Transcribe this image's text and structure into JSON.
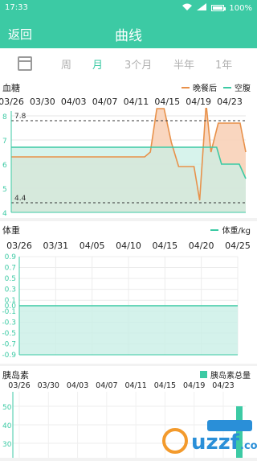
{
  "status_bar": {
    "time": "17:33",
    "battery": "100%",
    "battery_level": 1.0
  },
  "header": {
    "back_label": "返回",
    "title": "曲线"
  },
  "tabs": [
    {
      "label": "周",
      "active": false
    },
    {
      "label": "月",
      "active": true
    },
    {
      "label": "3个月",
      "active": false
    },
    {
      "label": "半年",
      "active": false
    },
    {
      "label": "1年",
      "active": false
    }
  ],
  "blood_sugar": {
    "title": "血糖",
    "legend_after": "晚餐后",
    "legend_fasting": "空腹"
  },
  "weight": {
    "title": "体重",
    "legend": "体重/kg"
  },
  "insulin": {
    "title": "胰岛素",
    "legend": "胰岛素总量"
  },
  "colors": {
    "accent": "#3ccaa4",
    "orange": "#e8914a",
    "orange_fill": "#f8d2b8",
    "teal_fill": "#c9efe6"
  },
  "chart_data": [
    {
      "type": "area",
      "title": "血糖",
      "x_ticks": [
        "03/26",
        "03/30",
        "04/03",
        "04/07",
        "04/11",
        "04/15",
        "04/19",
        "04/23"
      ],
      "ylim": [
        4,
        8.2
      ],
      "y_ticks": [
        4,
        5,
        6,
        7,
        8
      ],
      "reference_lines": [
        {
          "value": 7.8,
          "label": "7.8"
        },
        {
          "value": 4.4,
          "label": "4.4"
        }
      ],
      "grid": true,
      "legend": "top-right",
      "series": [
        {
          "name": "晚餐后",
          "color": "#e8914a",
          "points": [
            [
              0,
              6.3
            ],
            [
              16.5,
              6.3
            ],
            [
              17.2,
              6.5
            ],
            [
              18,
              8.3
            ],
            [
              18.9,
              8.3
            ],
            [
              19.8,
              6.9
            ],
            [
              20.7,
              5.9
            ],
            [
              22.6,
              5.9
            ],
            [
              23.3,
              4.5
            ],
            [
              24.1,
              8.5
            ],
            [
              24.7,
              6.5
            ],
            [
              25.6,
              7.7
            ],
            [
              28.3,
              7.7
            ],
            [
              29,
              6.5
            ]
          ]
        },
        {
          "name": "空腹",
          "color": "#3ccaa4",
          "points": [
            [
              0,
              6.7
            ],
            [
              25.4,
              6.7
            ],
            [
              26,
              6
            ],
            [
              28.2,
              6
            ],
            [
              29,
              5.4
            ]
          ]
        }
      ]
    },
    {
      "type": "area",
      "title": "体重",
      "x_ticks": [
        "03/26",
        "03/31",
        "04/05",
        "04/10",
        "04/15",
        "04/20",
        "04/25"
      ],
      "ylim": [
        -0.9,
        0.9
      ],
      "y_ticks": [
        "0.9",
        "0.7",
        "0.5",
        "0.3",
        "0.1",
        "-0.1",
        "-0.3",
        "-0.5",
        "-0.7",
        "-0.9"
      ],
      "y_tick_values": [
        0.9,
        0.7,
        0.5,
        0.3,
        0.1,
        -0.1,
        -0.3,
        -0.5,
        -0.7,
        -0.9
      ],
      "zero_label": "0.0",
      "series": [
        {
          "name": "体重/kg",
          "color": "#3ccaa4",
          "values": [
            0,
            0
          ]
        }
      ]
    },
    {
      "type": "bar",
      "title": "胰岛素",
      "x_ticks": [
        "03/26",
        "03/30",
        "04/03",
        "04/07",
        "04/11",
        "04/15",
        "04/19",
        "04/23"
      ],
      "y_ticks": [
        "50",
        "40",
        "30"
      ],
      "y_tick_values": [
        50,
        40,
        30
      ],
      "series": [
        {
          "name": "胰岛素总量",
          "color": "#3ccaa4",
          "values": [
            50
          ]
        }
      ]
    }
  ]
}
